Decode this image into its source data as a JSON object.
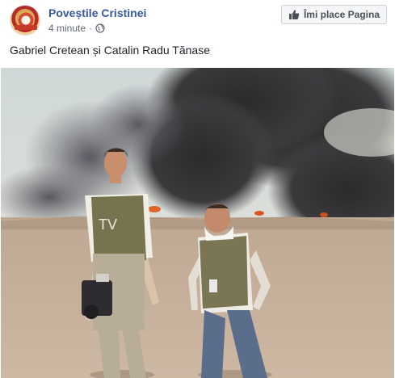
{
  "post": {
    "page_name": "Poveștile Cristinei",
    "timestamp": "4 minute",
    "audience_icon": "globe-icon",
    "like_button_label": "Îmi place Pagina",
    "like_icon": "thumbs-up-icon",
    "text": "Gabriel Cretean și Catalin Radu Tănase",
    "photo_vest_marking": "TV"
  },
  "colors": {
    "link": "#385898",
    "meta": "#606770",
    "button_bg": "#f5f6f7",
    "button_border": "#ccd0d5"
  }
}
